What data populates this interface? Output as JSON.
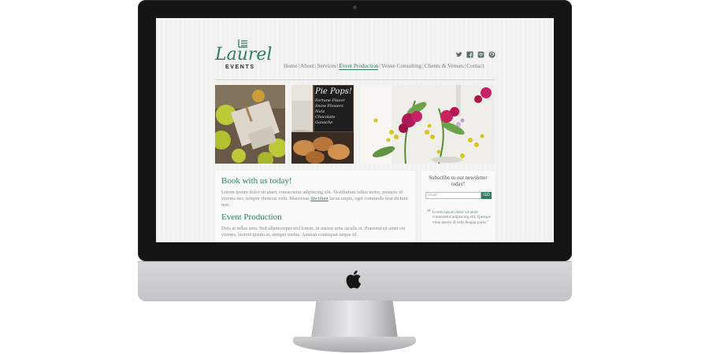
{
  "site": {
    "logo_word": "Laurel",
    "logo_sub": "EVENTS"
  },
  "social_icons": [
    "twitter-icon",
    "facebook-icon",
    "instagram-icon",
    "pinterest-icon"
  ],
  "nav": {
    "items": [
      {
        "label": "Home"
      },
      {
        "label": "About"
      },
      {
        "label": "Services"
      },
      {
        "label": "Event Production",
        "active": true
      },
      {
        "label": "Venue Consulting"
      },
      {
        "label": "Clients & Venues"
      },
      {
        "label": "Contact"
      }
    ],
    "separator": "|"
  },
  "main": {
    "book_heading": "Book with us today!",
    "book_text_a": "Lorem ipsum dolor sit amet, consectetur adipiscing elit. Vestibulum tellus tortor, posuere id viverra nec, tempor rhoncus velit. Maecenas ",
    "book_link": "tincidunt",
    "book_text_b": " lacus turpis, eget commodo erat dictum non.",
    "event_heading": "Event Production",
    "event_text": "Duis at tellus sem. Sed ullamcorper nisl lorem, in auctor urna iaculis et. Praesent sit amet est viverra, laoreet ipsum at, semper metus. Aenean consequat neque id"
  },
  "sidebar": {
    "subscribe_title": "Subscribe to our newsletter today!",
    "email_placeholder": "Email",
    "go_label": "GO",
    "quote_mark": "“",
    "quote_text": "Lorem ipsum dolor sit amet consectetur adipiscing elit. Quisque vitae ipsum id velit feugiat porta.”"
  },
  "photos": {
    "p2_chalk": [
      "Pie Pops!",
      "Fortune Flavor",
      "Snow Flowers Nuts",
      "Chocolate Ganache"
    ]
  },
  "colors": {
    "accent": "#2f7d64",
    "text_muted": "#8a8a8a",
    "bezel": "#141414",
    "aluminum": "#c9cacc"
  }
}
